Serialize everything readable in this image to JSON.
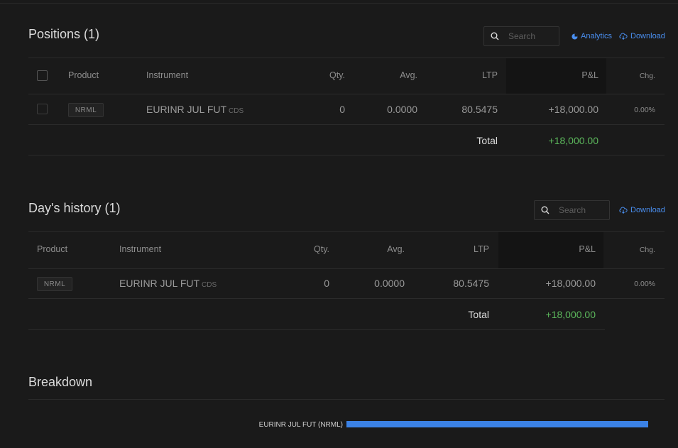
{
  "positions": {
    "title": "Positions (1)",
    "search_placeholder": "Search",
    "analytics_label": "Analytics",
    "download_label": "Download",
    "columns": {
      "product": "Product",
      "instrument": "Instrument",
      "qty": "Qty.",
      "avg": "Avg.",
      "ltp": "LTP",
      "pnl": "P&L",
      "chg": "Chg."
    },
    "rows": [
      {
        "product": "NRML",
        "instrument": "EURINR JUL FUT",
        "exchange": "CDS",
        "qty": "0",
        "avg": "0.0000",
        "ltp": "80.5475",
        "pnl": "+18,000.00",
        "chg": "0.00%"
      }
    ],
    "total_label": "Total",
    "total_value": "+18,000.00"
  },
  "history": {
    "title": "Day's history (1)",
    "search_placeholder": "Search",
    "download_label": "Download",
    "columns": {
      "product": "Product",
      "instrument": "Instrument",
      "qty": "Qty.",
      "avg": "Avg.",
      "ltp": "LTP",
      "pnl": "P&L",
      "chg": "Chg."
    },
    "rows": [
      {
        "product": "NRML",
        "instrument": "EURINR JUL FUT",
        "exchange": "CDS",
        "qty": "0",
        "avg": "0.0000",
        "ltp": "80.5475",
        "pnl": "+18,000.00",
        "chg": "0.00%"
      }
    ],
    "total_label": "Total",
    "total_value": "+18,000.00"
  },
  "breakdown": {
    "title": "Breakdown",
    "bars": [
      {
        "label": "EURINR JUL FUT (NRML)",
        "value": 18000,
        "fraction": 1.0
      }
    ]
  },
  "colors": {
    "accent": "#4a8ff0",
    "profit": "#5cb85c",
    "bar": "#3b82e6",
    "background": "#1a1a1a"
  }
}
